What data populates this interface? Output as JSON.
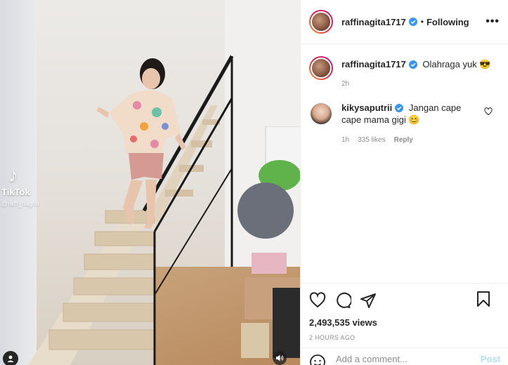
{
  "video": {
    "watermark_brand": "TikTok",
    "watermark_handle": "@raffi_nagita",
    "sound_icon": "speaker-icon",
    "user_tag_icon": "user-icon"
  },
  "post": {
    "author": "raffinagita1717",
    "follow_separator": "•",
    "follow_status": "Following",
    "more_icon": "more-dots-icon",
    "caption_author": "raffinagita1717",
    "caption_text": "Olahraga yuk 😎",
    "caption_time": "2h",
    "accent": "#0095f6"
  },
  "comments": [
    {
      "author": "kikysaputrii",
      "text": "Jangan cape cape mama gigi 😊",
      "time": "1h",
      "likes": "335 likes",
      "reply": "Reply"
    }
  ],
  "stats": {
    "views": "2,493,535 views",
    "posted": "2 HOURS AGO"
  },
  "composer": {
    "placeholder": "Add a comment...",
    "post_label": "Post"
  }
}
